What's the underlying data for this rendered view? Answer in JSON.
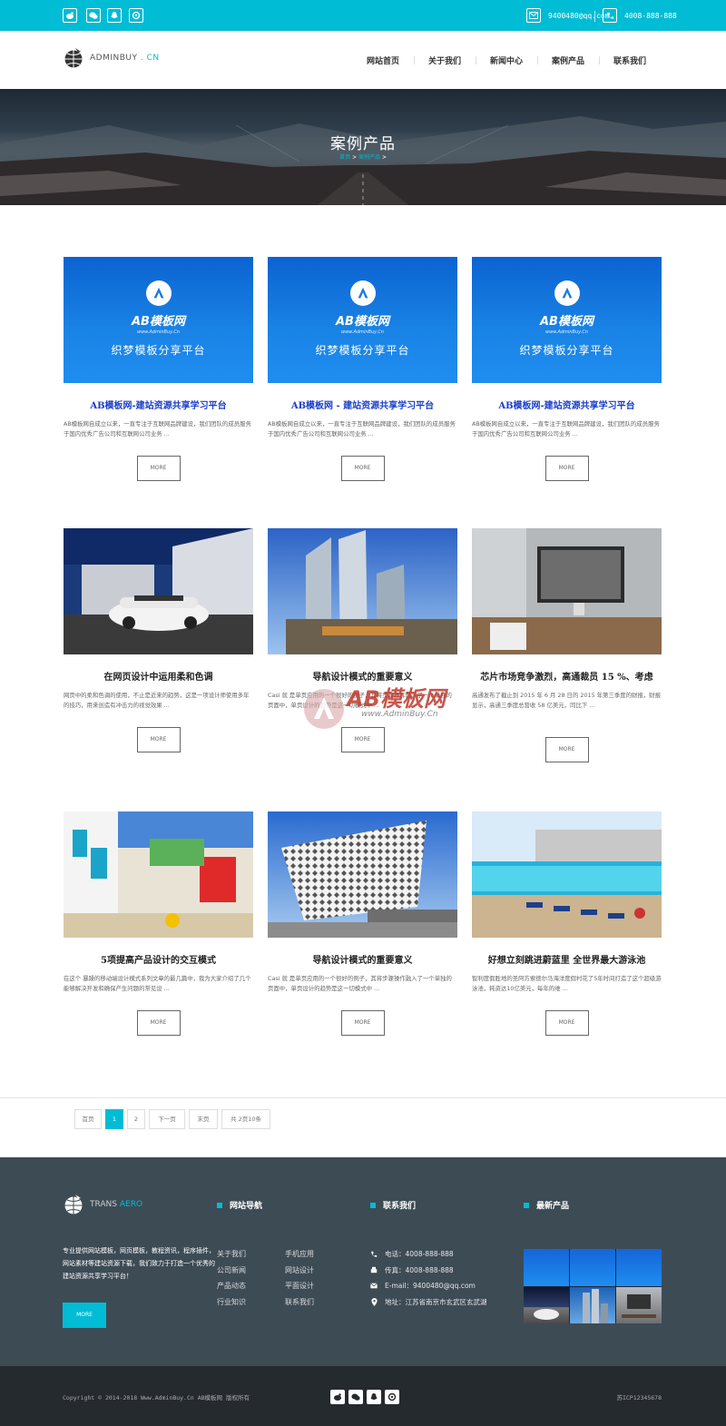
{
  "topbar": {
    "icons": [
      "weibo-icon",
      "wechat-icon",
      "qq-icon",
      "rss-icon"
    ],
    "email": "9400480@qq.com",
    "phone": "4008-888-888"
  },
  "header": {
    "logo_text": "ADMINBUY",
    "logo_suffix": ". CN",
    "nav": [
      "网站首页",
      "关于我们",
      "新闻中心",
      "案例产品",
      "联系我们"
    ]
  },
  "banner": {
    "title": "案例产品",
    "breadcrumb_home": "首页",
    "breadcrumb_sep": ">",
    "breadcrumb_current": "案例产品"
  },
  "products": [
    {
      "title": "AB模板网-建站资源共享学习平台",
      "desc": "AB模板网自成立以来，一直专注于互联网品牌建设，我们团队的成员服务于国内优秀广告公司和互联网公司业务 ...",
      "more": "MORE",
      "thumb": "ab"
    },
    {
      "title": "AB模板网 - 建站资源共享学习平台",
      "desc": "AB模板网自成立以来，一直专注于互联网品牌建设，我们团队的成员服务于国内优秀广告公司和互联网公司业务 ...",
      "more": "MORE",
      "thumb": "ab"
    },
    {
      "title": "AB模板网-建站资源共享学习平台",
      "desc": "AB模板网自成立以来，一直专注于互联网品牌建设，我们团队的成员服务于国内优秀广告公司和互联网公司业务 ...",
      "more": "MORE",
      "thumb": "ab"
    },
    {
      "title": "在网页设计中运用柔和色调",
      "desc": "网页中的柔和色调的使用，不止是近来的趋势，这是一项设计师使用多年的技巧，用来创造有冲击力的视觉效果 ...",
      "more": "MORE",
      "thumb": "car"
    },
    {
      "title": "导航设计模式的重要意义",
      "desc": "Casi 就 是单页应用的一个很好的例子，其将步骤操作融入了一个单独的页面中，单页设计的趋势是这一切模式中 ...",
      "more": "MORE",
      "thumb": "towers"
    },
    {
      "title": "芯片市场竞争激烈，高通裁员 15 %、考虑",
      "desc": "高通发布了截止到 2015 年 6 月 28 日的 2015 年第三季度的财报，财报显示，高通三季度总营收 58 亿美元，同比下 ...",
      "more": "MORE",
      "thumb": "office"
    },
    {
      "title": "5项提高产品设计的交互模式",
      "desc": "在这个 暴躁的移动端设计模式系列文章的最几篇中，我为大家介绍了几个能够解决开发和确保产生问题的常见设 ...",
      "more": "MORE",
      "thumb": "street"
    },
    {
      "title": "导航设计模式的重要意义",
      "desc": "Casi 就 是单页应用的一个很好的例子，其将步骤操作融入了一个单独的页面中，单页设计的趋势是这一切模式中 ...",
      "more": "MORE",
      "thumb": "building"
    },
    {
      "title": "好想立刻跳进蔚蓝里 全世界最大游泳池",
      "desc": "智利度假胜地的圣阿方索德尔马海洋度假村花了5年时间打造了这个超级游泳池，耗资达10亿美元，每年的维 ...",
      "more": "MORE",
      "thumb": "pool"
    }
  ],
  "ab_card": {
    "name": "AB模板网",
    "url": "www.AdminBuy.Cn",
    "slogan": "织梦模板分享平台"
  },
  "watermark": {
    "name": "AB模板网",
    "url": "www.AdminBuy.Cn"
  },
  "pagination": {
    "first": "首页",
    "pages": [
      "1",
      "2"
    ],
    "current": "1",
    "next": "下一页",
    "last": "末页",
    "total": "共 2页10条"
  },
  "footer": {
    "logo_text": "TRANS",
    "logo_suffix": "AERO",
    "nav_heading": "网站导航",
    "contact_heading": "联系我们",
    "products_heading": "最新产品",
    "about": "专业提供网站模板，网页模板，教程资讯，程序插件，网站素材等建站资源下载，我们致力于打造一个优秀的建站资源共享学习平台！",
    "more": "MORE",
    "links_col1": [
      "关于我们",
      "公司新闻",
      "产品动态",
      "行业知识"
    ],
    "links_col2": [
      "手机应用",
      "网站设计",
      "平面设计",
      "联系我们"
    ],
    "contacts": [
      {
        "icon": "phone-icon",
        "text": "电话：4008-888-888"
      },
      {
        "icon": "fax-icon",
        "text": "传真：4008-888-888"
      },
      {
        "icon": "mail-icon",
        "text": "E-mail：9400480@qq.com"
      },
      {
        "icon": "location-icon",
        "text": "地址：江苏省南京市玄武区玄武湖"
      }
    ]
  },
  "copyright": {
    "text": "Copyright © 2014-2018 Www.AdminBuy.Cn AB模板网 版权所有",
    "icp": "苏ICP12345678"
  },
  "colors": {
    "accent": "#00bcd4",
    "footer_bg": "#3d4b55",
    "copyright_bg": "#252a2f",
    "title_blue": "#1a3fc8"
  }
}
